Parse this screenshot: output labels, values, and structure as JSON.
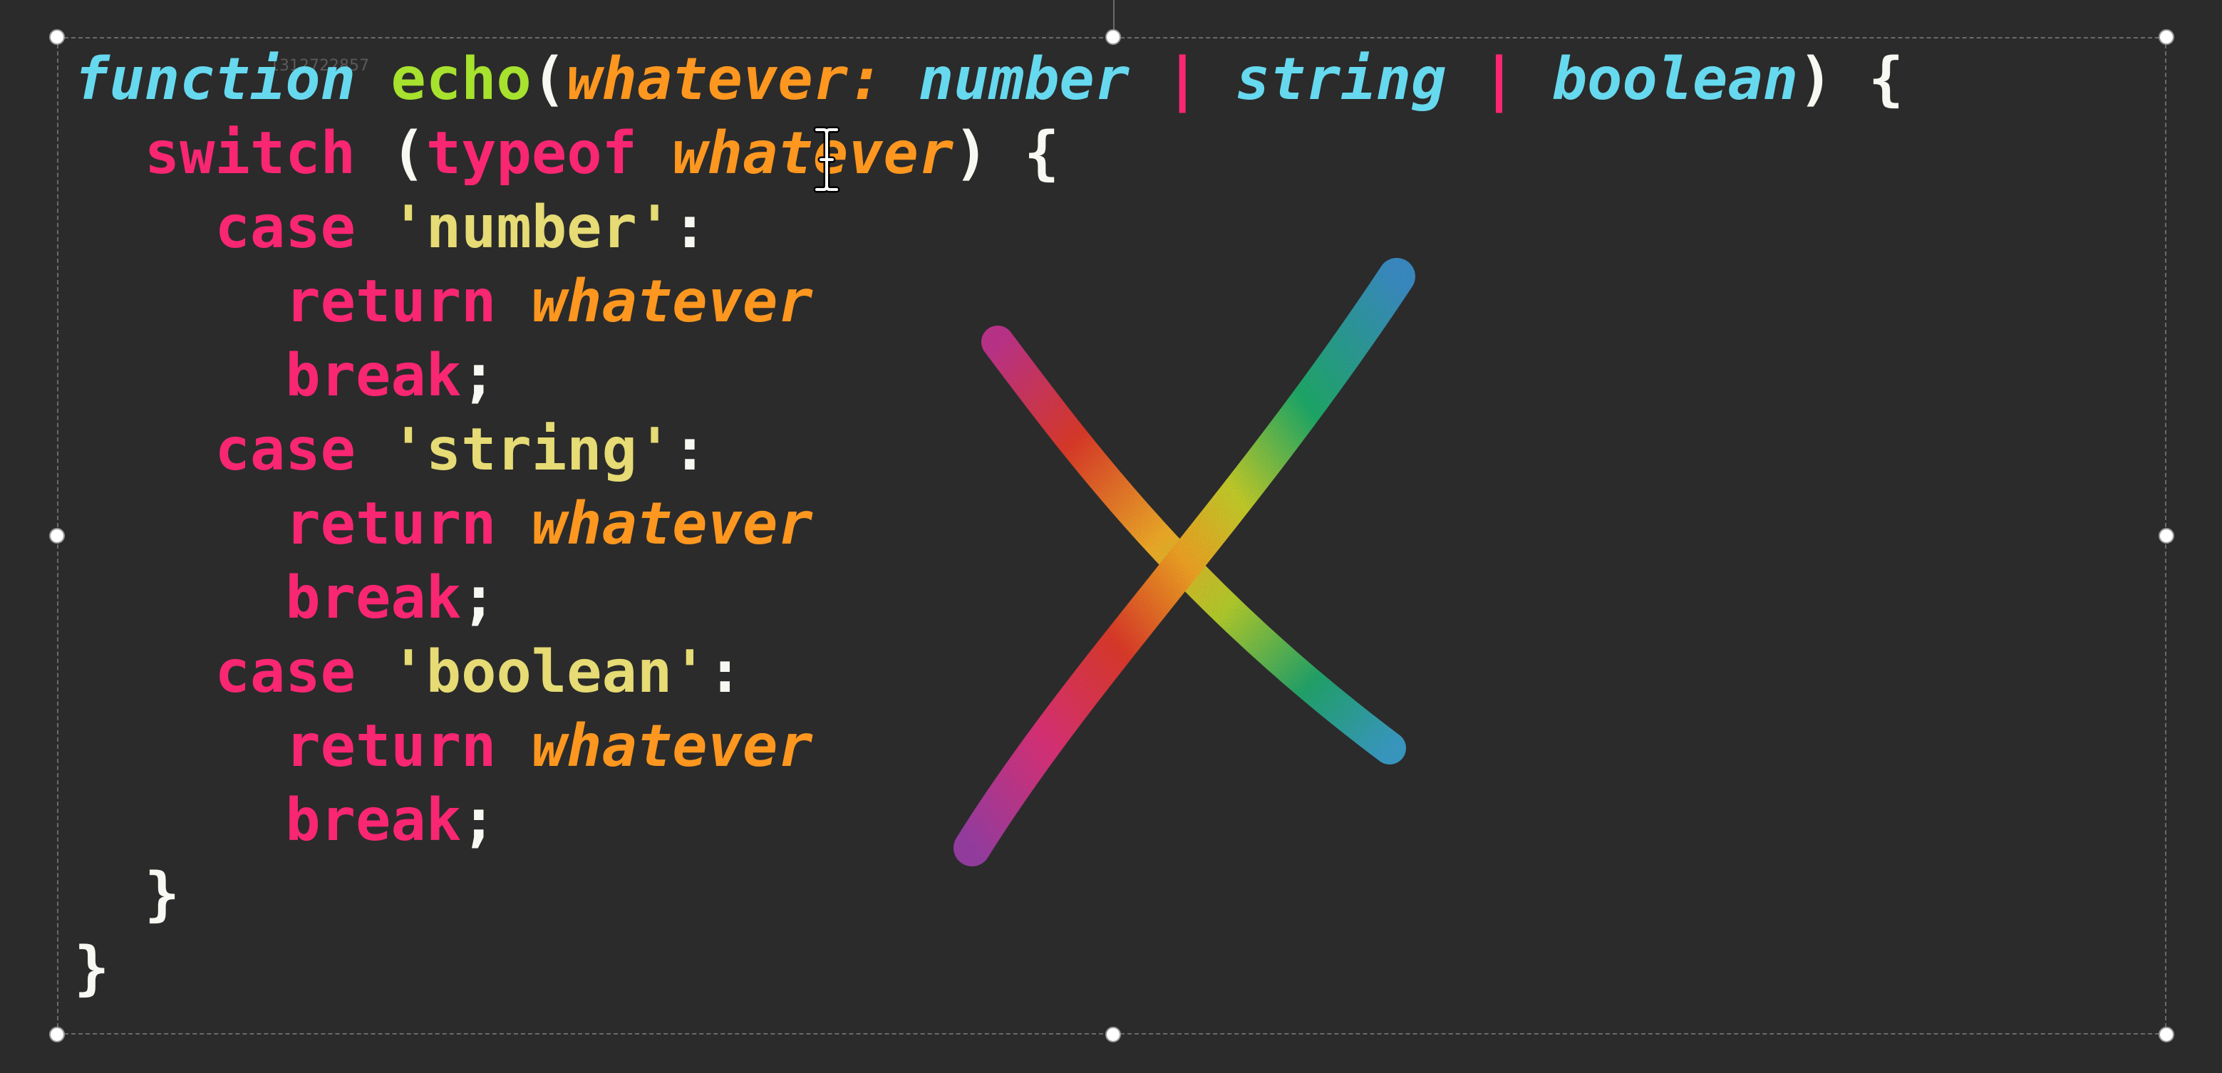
{
  "watermark": "1312722857",
  "code": {
    "line1": {
      "function_kw": "function",
      "fn_name": "echo",
      "open_paren": "(",
      "param": "whatever",
      "colon": ":",
      "type_number": "number",
      "pipe1": "|",
      "type_string": "string",
      "pipe2": "|",
      "type_boolean": "boolean",
      "close": ") {"
    },
    "line2": {
      "switch_kw": "switch",
      "open": "(",
      "typeof_kw": "typeof",
      "param": "whatever",
      "close": ") {"
    },
    "line3": {
      "case_kw": "case",
      "value": "'number'",
      "colon": ":"
    },
    "line4": {
      "return_kw": "return",
      "param": "whatever"
    },
    "line5": {
      "break_kw": "break",
      "semi": ";"
    },
    "line6": {
      "case_kw": "case",
      "value": "'string'",
      "colon": ":"
    },
    "line7": {
      "return_kw": "return",
      "param": "whatever"
    },
    "line8": {
      "break_kw": "break",
      "semi": ";"
    },
    "line9": {
      "case_kw": "case",
      "value": "'boolean'",
      "colon": ":"
    },
    "line10": {
      "return_kw": "return",
      "param": "whatever"
    },
    "line11": {
      "break_kw": "break",
      "semi": ";"
    },
    "line12": {
      "brace": "}"
    },
    "line13": {
      "brace": "}"
    }
  },
  "icons": {
    "cursor": "text-cursor-icon",
    "overlay": "rainbow-x-mark-icon"
  },
  "colors": {
    "background": "#2b2b2b",
    "keyword": "#f92672",
    "type": "#66d9ef",
    "function_name": "#a6e22e",
    "parameter": "#fd971f",
    "string": "#e6db74"
  }
}
